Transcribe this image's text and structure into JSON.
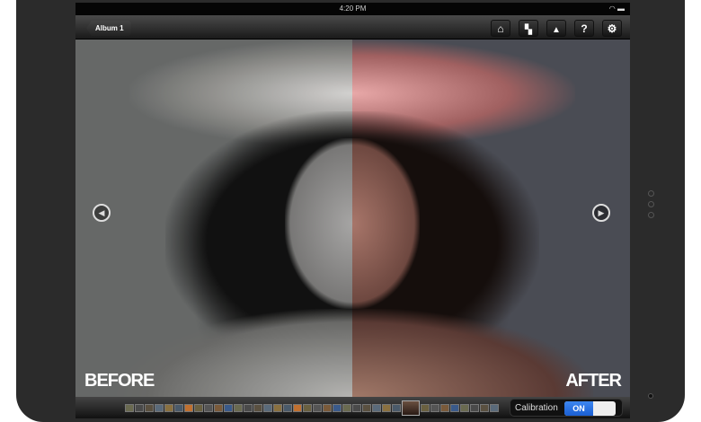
{
  "status_bar": {
    "time": "4:20 PM",
    "indicators": "wifi battery"
  },
  "nav": {
    "back_label": "Album 1",
    "buttons": [
      "home",
      "layers",
      "flask",
      "help",
      "settings"
    ],
    "help_glyph": "?"
  },
  "photo": {
    "before_label": "BEFORE",
    "after_label": "AFTER",
    "prev_glyph": "◀",
    "next_glyph": "▶"
  },
  "bottom": {
    "calibration_label": "Calibration",
    "toggle_state": "ON",
    "thumbnail_count": 37,
    "selected_index": 28,
    "accent": "#2a72e6"
  }
}
